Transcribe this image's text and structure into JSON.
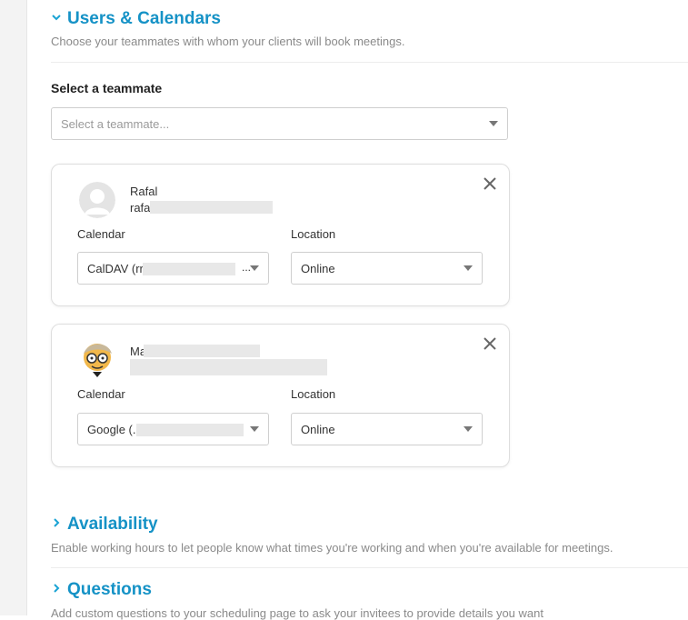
{
  "users_calendars": {
    "chevron": "˅",
    "title": "Users & Calendars",
    "description": "Choose your teammates with whom your clients will book meetings.",
    "select_label": "Select a teammate",
    "select_placeholder": "Select a teammate..."
  },
  "teammates": [
    {
      "name": "Rafal",
      "email": "rafa",
      "calendar_label": "Calendar",
      "calendar_value": "CalDAV (rr",
      "calendar_trailing": "...",
      "location_label": "Location",
      "location_value": "Online",
      "avatar_icon": "default-user-avatar-icon"
    },
    {
      "name": "Ma",
      "email": "",
      "calendar_label": "Calendar",
      "calendar_value": "Google (.",
      "calendar_trailing": "",
      "location_label": "Location",
      "location_value": "Online",
      "avatar_icon": "cartoon-avatar-icon"
    }
  ],
  "availability": {
    "chevron": "›",
    "title": "Availability",
    "description": "Enable working hours to let people know what times you're working and when you're available for meetings."
  },
  "questions": {
    "chevron": "›",
    "title": "Questions",
    "description": "Add custom questions to your scheduling page to ask your invitees to provide details you want"
  },
  "colors": {
    "accent": "#1592c6",
    "muted": "#8a8a8a",
    "border": "#cfcfcf"
  }
}
